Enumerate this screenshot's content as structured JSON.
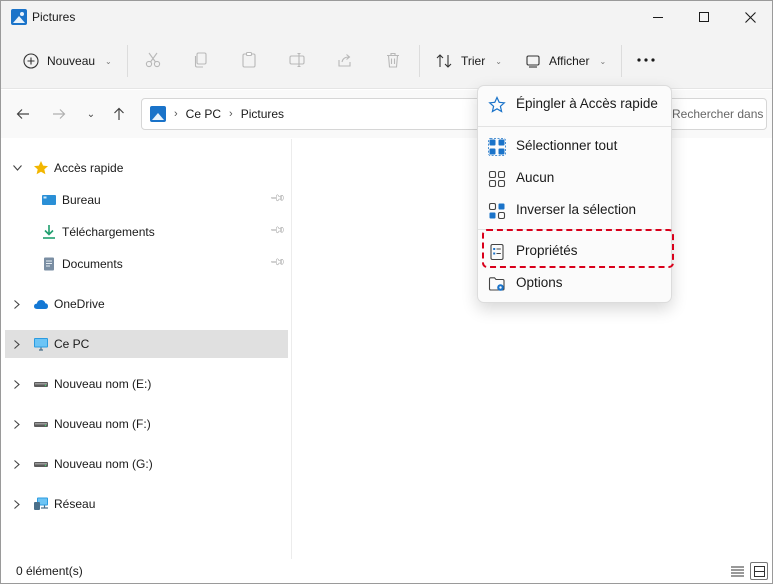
{
  "window": {
    "title": "Pictures"
  },
  "command_bar": {
    "new_label": "Nouveau",
    "sort_label": "Trier",
    "view_label": "Afficher",
    "more_icon": "ellipsis-icon"
  },
  "address": {
    "segments": [
      "Ce PC",
      "Pictures"
    ],
    "search_placeholder": "Rechercher dans : Pictures"
  },
  "sidebar": {
    "items": [
      {
        "label": "Accès rapide",
        "icon": "star-icon"
      },
      {
        "label": "Bureau",
        "icon": "desktop-icon"
      },
      {
        "label": "Téléchargements",
        "icon": "download-icon"
      },
      {
        "label": "Documents",
        "icon": "documents-icon"
      },
      {
        "label": "OneDrive",
        "icon": "cloud-icon"
      },
      {
        "label": "Ce PC",
        "icon": "monitor-icon"
      },
      {
        "label": "Nouveau nom (E:)",
        "icon": "drive-icon"
      },
      {
        "label": "Nouveau nom (F:)",
        "icon": "drive-icon"
      },
      {
        "label": "Nouveau nom (G:)",
        "icon": "drive-icon"
      },
      {
        "label": "Réseau",
        "icon": "network-icon"
      }
    ]
  },
  "menu": {
    "items": [
      {
        "label": "Épingler à Accès rapide",
        "icon": "pin-star-icon"
      },
      {
        "label": "Sélectionner tout",
        "icon": "select-all-icon"
      },
      {
        "label": "Aucun",
        "icon": "select-none-icon"
      },
      {
        "label": "Inverser la sélection",
        "icon": "invert-selection-icon"
      },
      {
        "label": "Propriétés",
        "icon": "properties-icon"
      },
      {
        "label": "Options",
        "icon": "folder-options-icon"
      }
    ]
  },
  "status": {
    "count_text": "0 élément(s)"
  },
  "colors": {
    "accent": "#1a73c9",
    "highlight": "#d9001b",
    "selected_bg": "#e0e0e0",
    "star": "#f2b600"
  }
}
